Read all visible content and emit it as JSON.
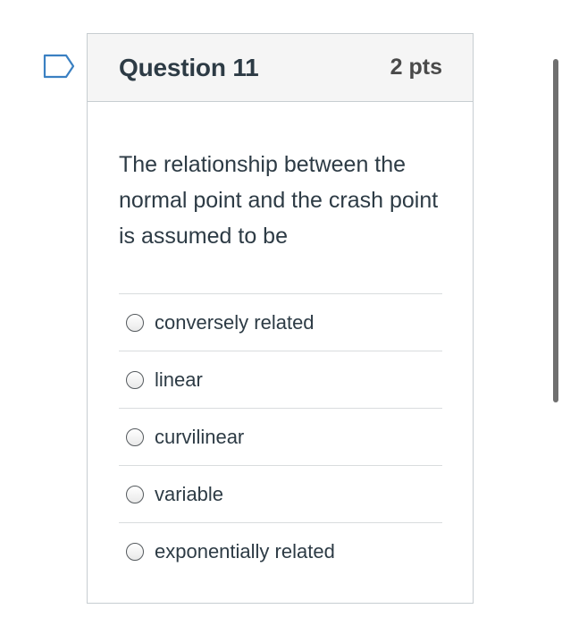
{
  "question": {
    "title": "Question 11",
    "points": "2 pts",
    "text": "The relationship between the normal point and the crash point is assumed to be",
    "answers": [
      {
        "label": "conversely related"
      },
      {
        "label": "linear"
      },
      {
        "label": "curvilinear"
      },
      {
        "label": "variable"
      },
      {
        "label": "exponentially related"
      }
    ]
  },
  "icons": {
    "flag": "flag-icon",
    "radio": "radio-unchecked-icon"
  },
  "colors": {
    "flag_outline": "#3a80c2",
    "header_bg": "#f5f5f5",
    "border": "#c7cdd1",
    "text": "#2d3b45"
  }
}
